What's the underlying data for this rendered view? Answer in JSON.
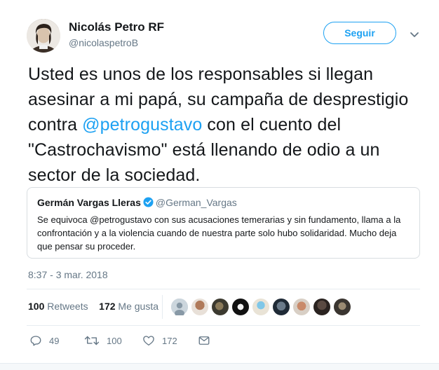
{
  "author": {
    "name": "Nicolás Petro RF",
    "handle": "@nicolaspetroB"
  },
  "follow_button": "Seguir",
  "tweet_text": {
    "part1": "Usted es unos de los responsables si llegan asesinar a mi papá, su campaña de desprestigio contra ",
    "mention": "@petrogustavo",
    "part2": " con el cuento del \"Castrochavismo\" está llenando de odio a un sector de la sociedad."
  },
  "quoted_tweet": {
    "name": "Germán Vargas Lleras",
    "handle": "@German_Vargas",
    "text": "Se equivoca @petrogustavo con sus acusaciones temerarias y sin fundamento, llama a la confrontación y a la violencia cuando de nuestra parte solo hubo solidaridad. Mucho deja que pensar su proceder."
  },
  "timestamp": "8:37 - 3 mar. 2018",
  "stats": {
    "retweets_count": "100",
    "retweets_label": "Retweets",
    "likes_count": "172",
    "likes_label": "Me gusta"
  },
  "actions": {
    "reply_count": "49",
    "retweet_count": "100",
    "like_count": "172"
  },
  "colors": {
    "accent": "#1da1f2",
    "secondary_text": "#657786"
  }
}
